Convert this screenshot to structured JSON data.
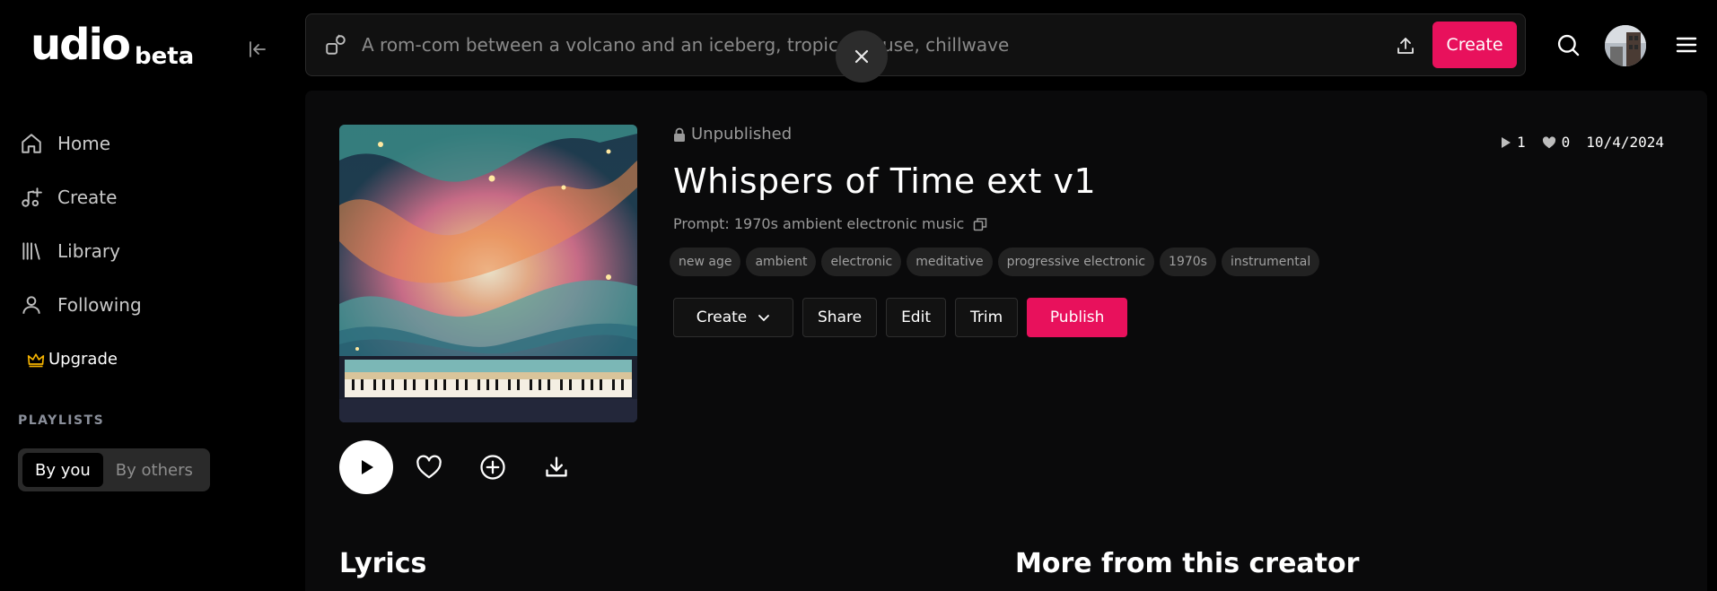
{
  "brand": {
    "name": "udio",
    "badge": "beta"
  },
  "sidebar": {
    "items": [
      {
        "label": "Home",
        "icon": "home-icon"
      },
      {
        "label": "Create",
        "icon": "music-plus-icon"
      },
      {
        "label": "Library",
        "icon": "library-icon"
      },
      {
        "label": "Following",
        "icon": "user-icon"
      }
    ],
    "upgrade_label": "Upgrade",
    "playlists_title": "PLAYLISTS",
    "playlist_tabs": [
      "By you",
      "By others"
    ],
    "playlist_active": "By you"
  },
  "topbar": {
    "placeholder": "A rom-com between a volcano and an iceberg, tropical house, chillwave",
    "create_label": "Create"
  },
  "song": {
    "status": "Unpublished",
    "title": "Whispers of Time ext v1",
    "prompt": "Prompt: 1970s ambient electronic music",
    "tags": [
      "new age",
      "ambient",
      "electronic",
      "meditative",
      "progressive electronic",
      "1970s",
      "instrumental"
    ],
    "plays": "1",
    "likes": "0",
    "date": "10/4/2024",
    "actions": {
      "create": "Create",
      "share": "Share",
      "edit": "Edit",
      "trim": "Trim",
      "publish": "Publish"
    }
  },
  "sections": {
    "lyrics": "Lyrics",
    "more": "More from this creator"
  },
  "colors": {
    "accent": "#e8115c",
    "crown": "#f5b300"
  }
}
